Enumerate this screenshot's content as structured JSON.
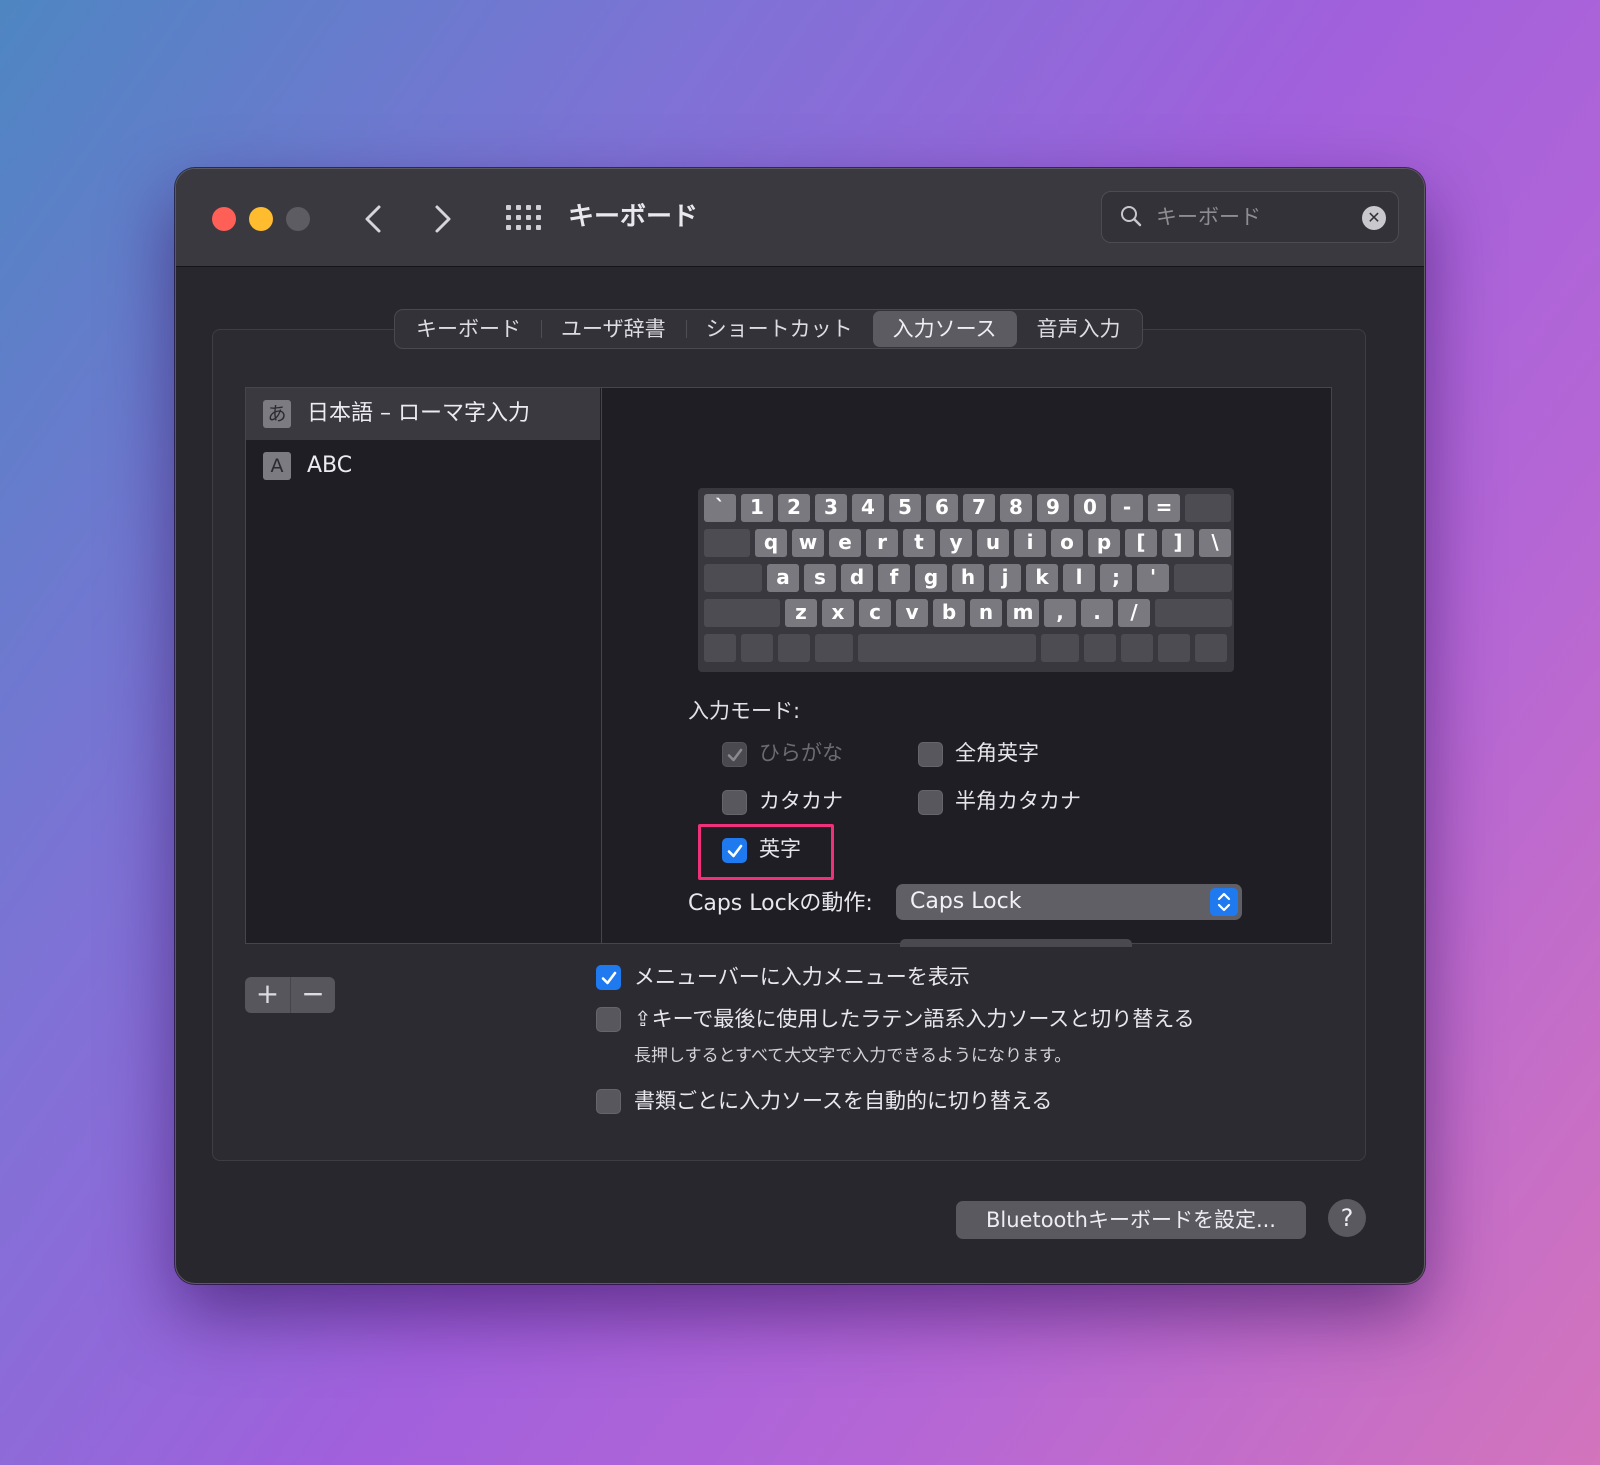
{
  "window": {
    "title": "キーボード",
    "search": {
      "placeholder": "キーボード"
    }
  },
  "tabs": [
    {
      "label": "キーボード",
      "active": false
    },
    {
      "label": "ユーザ辞書",
      "active": false
    },
    {
      "label": "ショートカット",
      "active": false
    },
    {
      "label": "入力ソース",
      "active": true
    },
    {
      "label": "音声入力",
      "active": false
    }
  ],
  "sources": [
    {
      "badge": "あ",
      "label": "日本語 – ローマ字入力",
      "selected": true
    },
    {
      "badge": "A",
      "label": "ABC",
      "selected": false
    }
  ],
  "keyboard": {
    "row1": [
      "`",
      "1",
      "2",
      "3",
      "4",
      "5",
      "6",
      "7",
      "8",
      "9",
      "0",
      "-",
      "="
    ],
    "row2": [
      "q",
      "w",
      "e",
      "r",
      "t",
      "y",
      "u",
      "i",
      "o",
      "p",
      "[",
      "]",
      "\\"
    ],
    "row3": [
      "a",
      "s",
      "d",
      "f",
      "g",
      "h",
      "j",
      "k",
      "l",
      ";",
      "'"
    ],
    "row4": [
      "z",
      "x",
      "c",
      "v",
      "b",
      "n",
      "m",
      ",",
      ".",
      "/"
    ]
  },
  "input_mode": {
    "label": "入力モード:",
    "options": [
      {
        "label": "ひらがな",
        "checked": true,
        "disabled": true
      },
      {
        "label": "全角英字",
        "checked": false,
        "disabled": false
      },
      {
        "label": "カタカナ",
        "checked": false,
        "disabled": false
      },
      {
        "label": "半角カタカナ",
        "checked": false,
        "disabled": false
      },
      {
        "label": "英字",
        "checked": true,
        "disabled": false
      }
    ]
  },
  "caps_lock": {
    "label": "Caps Lockの動作:",
    "value": "Caps Lock"
  },
  "list_controls": {
    "add": "+",
    "remove": "−"
  },
  "options": [
    {
      "label": "メニューバーに入力メニューを表示",
      "checked": true
    },
    {
      "label": "⇪キーで最後に使用したラテン語系入力ソースと切り替える",
      "checked": false,
      "note": "長押しするとすべて大文字で入力できるようになります。"
    },
    {
      "label": "書類ごとに入力ソースを自動的に切り替える",
      "checked": false
    }
  ],
  "bluetooth_button": "Bluetoothキーボードを設定...",
  "help_button": "?",
  "colors": {
    "accent": "#1f7af0",
    "highlight": "#f0307a",
    "window_bg": "#28272e"
  }
}
